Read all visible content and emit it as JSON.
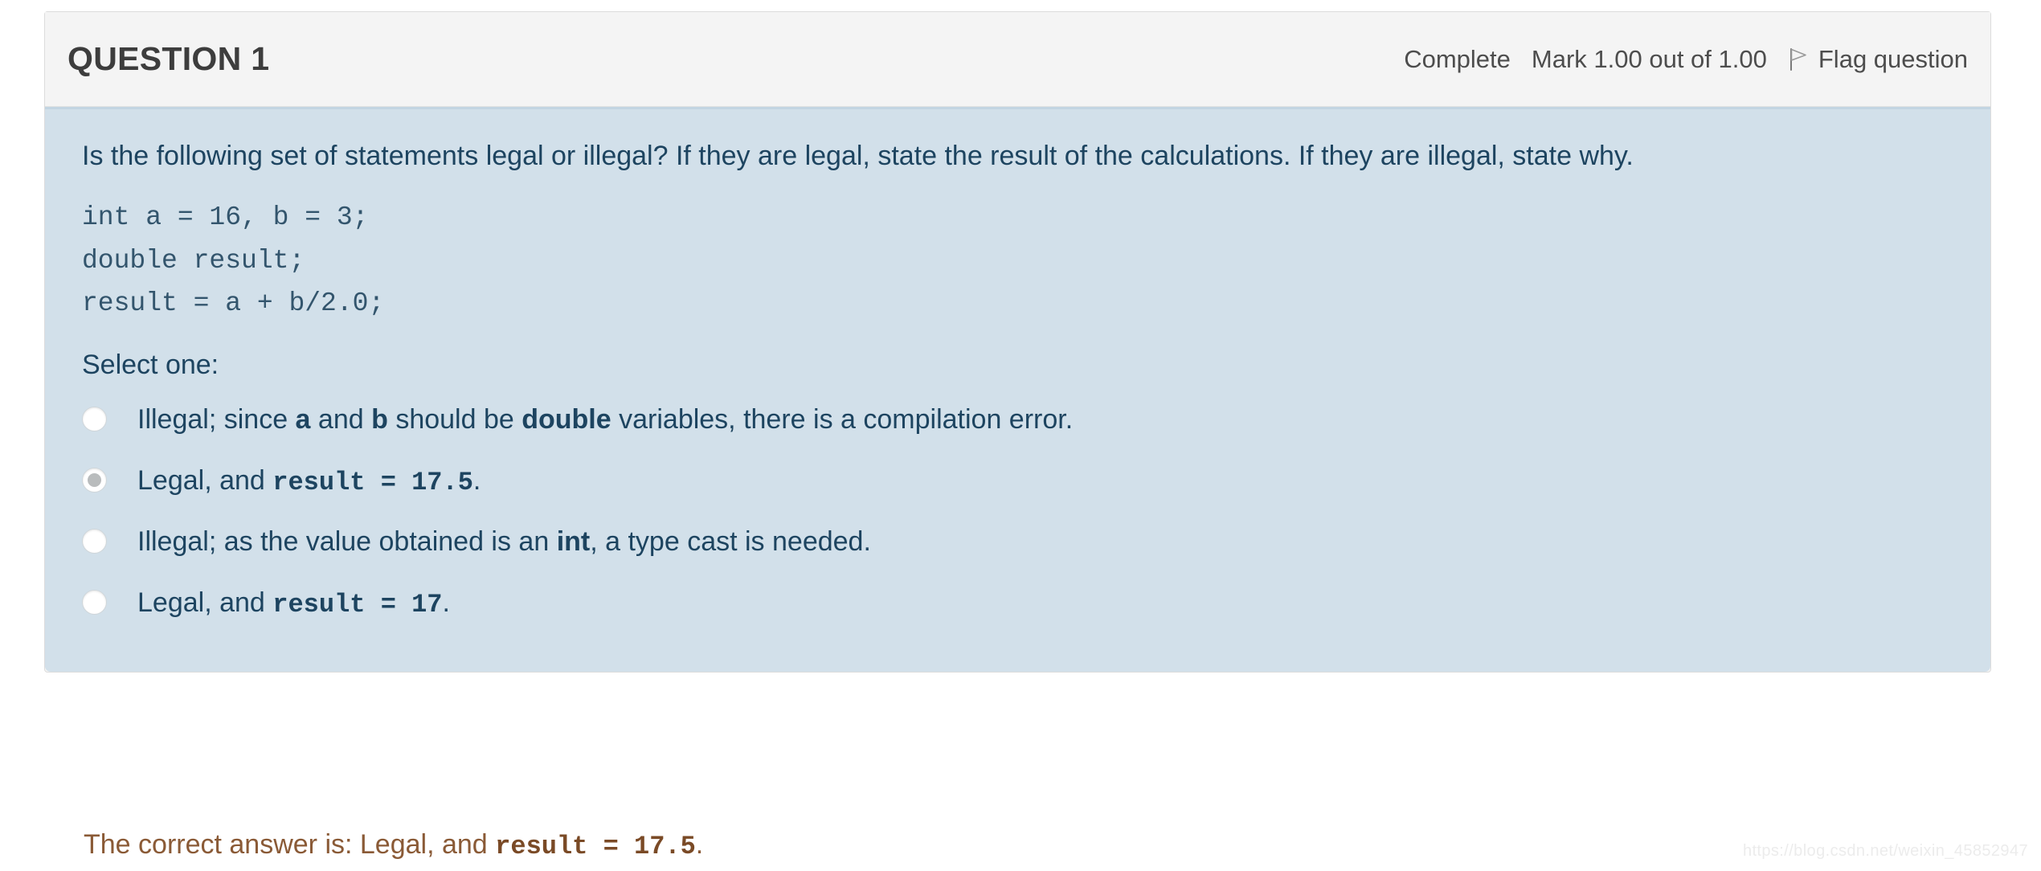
{
  "question": {
    "number_label": "QUESTION 1",
    "state": "Complete",
    "grade": "Mark 1.00 out of 1.00",
    "flag_label": "Flag question",
    "flag_icon": "flag-outline-icon",
    "prompt": "Is the following set of statements legal or illegal? If they are legal, state the result of the calculations. If they are illegal, state why.",
    "code": "int a = 16, b = 3;\ndouble result;\nresult = a + b/2.0;",
    "select_one_label": "Select one:",
    "answers": [
      {
        "id": "a",
        "selected": false,
        "parts": [
          {
            "text": "Illegal; since ",
            "style": "plain"
          },
          {
            "text": "a",
            "style": "bold"
          },
          {
            "text": " and ",
            "style": "plain"
          },
          {
            "text": "b",
            "style": "bold"
          },
          {
            "text": " should be ",
            "style": "plain"
          },
          {
            "text": "double",
            "style": "bold"
          },
          {
            "text": " variables, there is a compilation error.",
            "style": "plain"
          }
        ]
      },
      {
        "id": "b",
        "selected": true,
        "parts": [
          {
            "text": "Legal, and ",
            "style": "plain"
          },
          {
            "text": "result = 17.5",
            "style": "code"
          },
          {
            "text": ".",
            "style": "plain"
          }
        ]
      },
      {
        "id": "c",
        "selected": false,
        "parts": [
          {
            "text": "Illegal; as the value obtained is an ",
            "style": "plain"
          },
          {
            "text": "int",
            "style": "bold"
          },
          {
            "text": ", a type cast is needed.",
            "style": "plain"
          }
        ]
      },
      {
        "id": "d",
        "selected": false,
        "parts": [
          {
            "text": "Legal, and ",
            "style": "plain"
          },
          {
            "text": "result = 17",
            "style": "code"
          },
          {
            "text": ".",
            "style": "plain"
          }
        ]
      }
    ]
  },
  "feedback": {
    "parts": [
      {
        "text": "The correct answer is: Legal, and ",
        "style": "plain"
      },
      {
        "text": "result = 17.5",
        "style": "code"
      },
      {
        "text": ".",
        "style": "plain"
      }
    ]
  },
  "watermark": {
    "text": "https://blog.csdn.net/weixin_45852947"
  },
  "colors": {
    "header_bg": "#f4f4f4",
    "body_bg": "#d2e0ea",
    "question_text": "#1d4460",
    "code_text": "#33556d",
    "feedback_text": "#8a5a36",
    "radio_fill": "#b9bcbd"
  }
}
